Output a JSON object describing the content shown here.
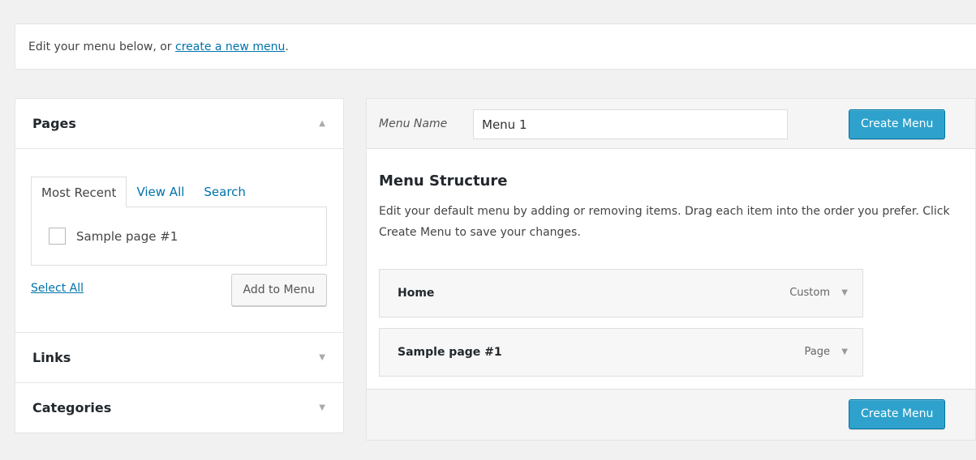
{
  "notice": {
    "text": "Edit your menu below, or ",
    "link": "create a new menu",
    "suffix": "."
  },
  "left": {
    "pages": {
      "title": "Pages",
      "arrow": "▲",
      "tabs": [
        "Most Recent",
        "View All",
        "Search"
      ],
      "items": [
        "Sample page #1"
      ],
      "select_all": "Select All",
      "add_button": "Add to Menu"
    },
    "links": {
      "title": "Links",
      "arrow": "▼"
    },
    "categories": {
      "title": "Categories",
      "arrow": "▼"
    }
  },
  "right": {
    "menu_name_label": "Menu Name",
    "menu_name_value": "Menu 1",
    "create_button": "Create Menu",
    "structure_title": "Menu Structure",
    "description": "Edit your default menu by adding or removing items. Drag each item into the order you prefer. Click Create Menu to save your changes.",
    "items": [
      {
        "label": "Home",
        "type": "Custom",
        "arrow": "▼"
      },
      {
        "label": "Sample page #1",
        "type": "Page",
        "arrow": "▼"
      }
    ]
  }
}
